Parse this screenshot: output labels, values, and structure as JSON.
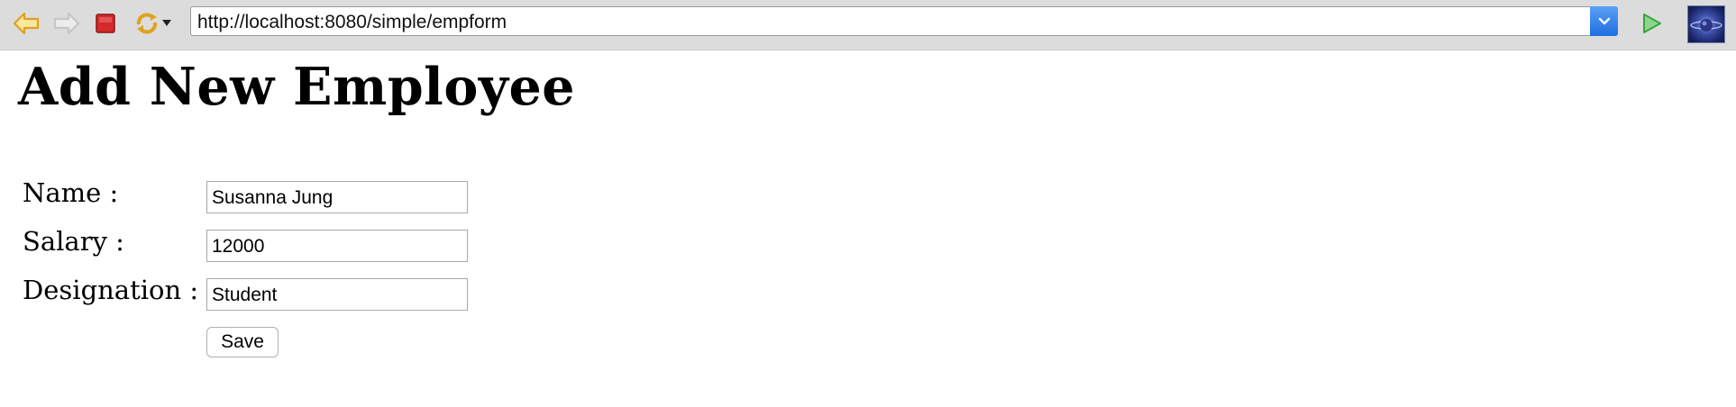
{
  "browser": {
    "url": "http://localhost:8080/simple/empform",
    "icons": {
      "back": "back-arrow-icon",
      "forward": "forward-arrow-icon",
      "stop": "stop-icon",
      "refresh": "refresh-icon",
      "dropdown": "chevron-down-icon",
      "go": "go-arrow-icon",
      "globe": "globe-icon"
    },
    "colors": {
      "toolbar": "#dcdcdc",
      "back_arrow": "#f0b429",
      "stop": "#d42a2a",
      "go": "#3aa63a",
      "url_dropdown": "#1f6fe0"
    }
  },
  "page": {
    "title": "Add New Employee",
    "form": {
      "name_label": "Name :",
      "name_value": "Susanna Jung",
      "salary_label": "Salary :",
      "salary_value": "12000",
      "designation_label": "Designation :",
      "designation_value": "Student",
      "save_label": "Save"
    }
  }
}
